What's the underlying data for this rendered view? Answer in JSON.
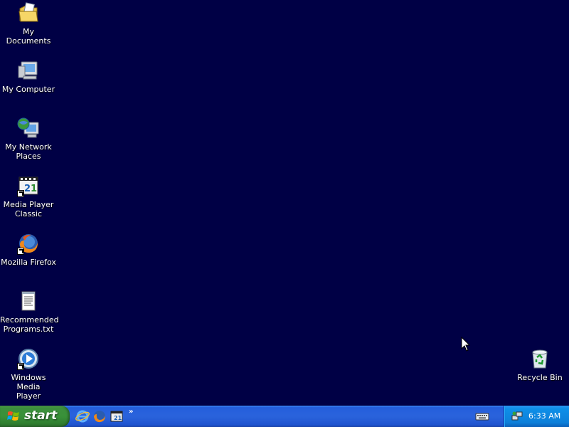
{
  "desktop": {
    "background": "#000045",
    "icons": [
      {
        "label": "My Documents",
        "icon": "my-documents-icon"
      },
      {
        "label": "My Computer",
        "icon": "my-computer-icon"
      },
      {
        "label": "My Network\nPlaces",
        "icon": "my-network-places-icon"
      },
      {
        "label": "Media Player\nClassic",
        "icon": "media-player-classic-icon"
      },
      {
        "label": "Mozilla Firefox",
        "icon": "firefox-icon"
      },
      {
        "label": "Recommended\nPrograms.txt",
        "icon": "text-file-icon"
      },
      {
        "label": "Windows Media\nPlayer",
        "icon": "windows-media-player-icon"
      },
      {
        "label": "Recycle Bin",
        "icon": "recycle-bin-icon"
      }
    ]
  },
  "taskbar": {
    "start_label": "start",
    "quick_launch": [
      "ie-icon",
      "firefox-icon",
      "media-player-classic-icon"
    ],
    "more": "»",
    "tray": {
      "clock": "6:33 AM"
    }
  }
}
